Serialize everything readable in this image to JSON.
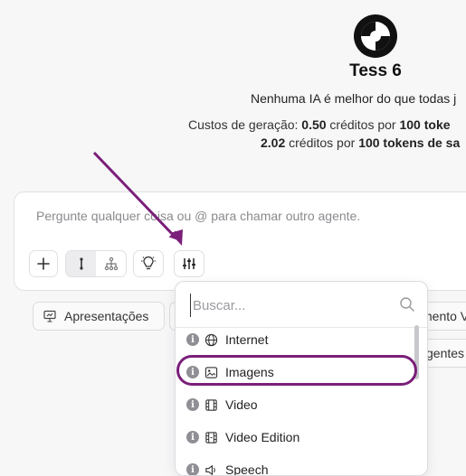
{
  "agent": {
    "name": "Tess 6",
    "tagline": "Nenhuma IA é melhor do que todas j",
    "cost_line1_prefix": "Custos de geração: ",
    "cost_line1_value": "0.50",
    "cost_line1_mid": " créditos por ",
    "cost_line1_tokens": "100 toke",
    "cost_line2_value": "2.02",
    "cost_line2_mid": " créditos por ",
    "cost_line2_tokens": "100 tokens de sa"
  },
  "composer": {
    "placeholder": "Pergunte qualquer coisa ou @ para chamar outro agente."
  },
  "toolbar": {
    "add_icon": "plus-icon",
    "mode_text_icon": "text-cursor-icon",
    "mode_flow_icon": "hierarchy-icon",
    "idea_icon": "lightbulb-icon",
    "tools_icon": "sliders-icon"
  },
  "chips": [
    {
      "label": "Apresentações",
      "icon": "presentation-icon"
    },
    {
      "label": "mento V"
    },
    {
      "label": "gentes"
    }
  ],
  "tools_menu": {
    "search_placeholder": "Buscar...",
    "items": [
      {
        "label": "Internet",
        "icon": "globe-icon"
      },
      {
        "label": "Imagens",
        "icon": "image-icon"
      },
      {
        "label": "Video",
        "icon": "film-icon"
      },
      {
        "label": "Video Edition",
        "icon": "film-edit-icon"
      },
      {
        "label": "Speech",
        "icon": "speaker-icon"
      }
    ]
  },
  "colors": {
    "annotation": "#7a1f7a",
    "background": "#f7f7f8"
  }
}
